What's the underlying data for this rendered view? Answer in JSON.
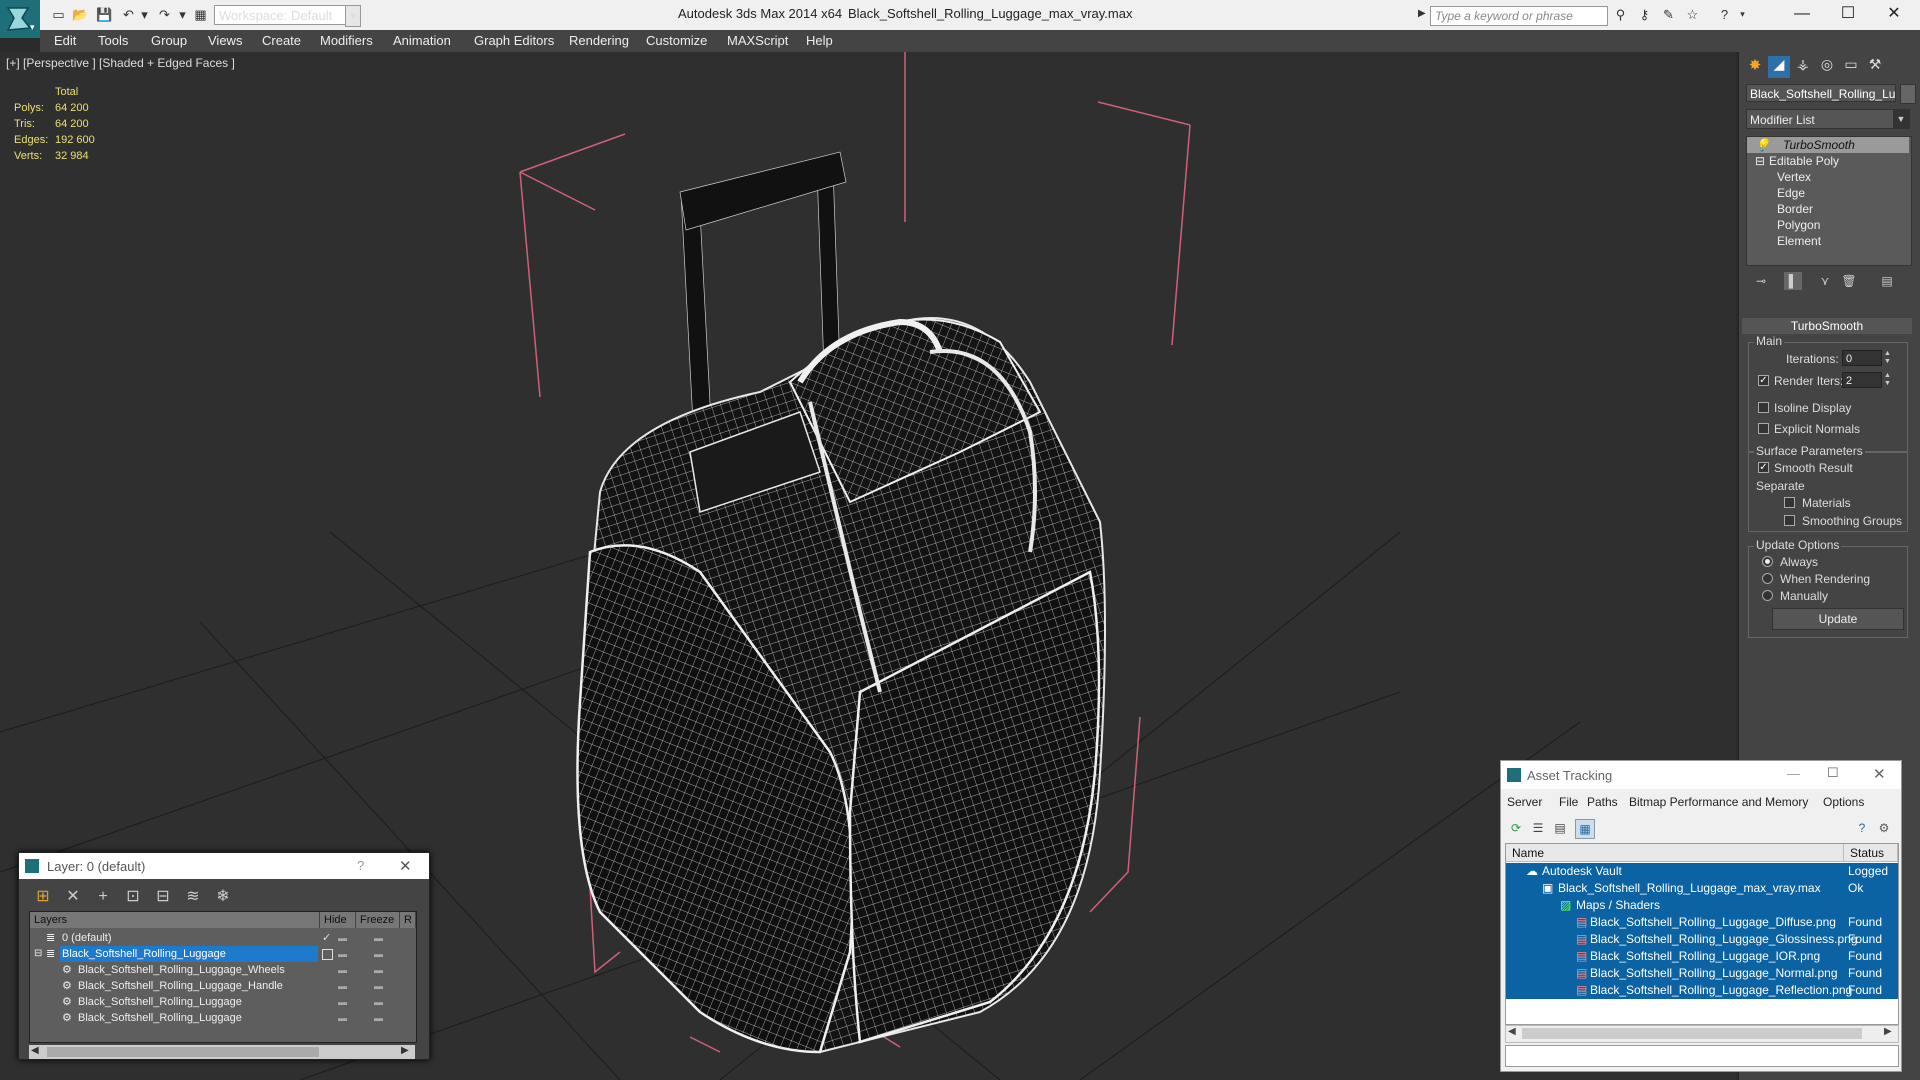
{
  "titlebar": {
    "workspace": "Workspace: Default",
    "app_title": "Autodesk 3ds Max  2014 x64",
    "file_title": "Black_Softshell_Rolling_Luggage_max_vray.max",
    "search_placeholder": "Type a keyword or phrase"
  },
  "menu": [
    "Edit",
    "Tools",
    "Group",
    "Views",
    "Create",
    "Modifiers",
    "Animation",
    "Graph Editors",
    "Rendering",
    "Customize",
    "MAXScript",
    "Help"
  ],
  "viewport": {
    "label": "[+] [Perspective ] [Shaded + Edged Faces ]",
    "stats": {
      "header": "Total",
      "polys_label": "Polys:",
      "polys": "64 200",
      "tris_label": "Tris:",
      "tris": "64 200",
      "edges_label": "Edges:",
      "edges": "192 600",
      "verts_label": "Verts:",
      "verts": "32 984"
    }
  },
  "command_panel": {
    "object_name": "Black_Softshell_Rolling_Luggage",
    "modifier_list": "Modifier List",
    "stack": [
      "TurboSmooth",
      "Editable Poly",
      "Vertex",
      "Edge",
      "Border",
      "Polygon",
      "Element"
    ],
    "rollout_title": "TurboSmooth",
    "main_label": "Main",
    "iterations_label": "Iterations:",
    "iterations_value": "0",
    "render_iters_label": "Render Iters:",
    "render_iters_value": "2",
    "isoline_label": "Isoline Display",
    "explicit_normals_label": "Explicit Normals",
    "surface_params_label": "Surface Parameters",
    "smooth_result_label": "Smooth Result",
    "separate_label": "Separate",
    "materials_label": "Materials",
    "smoothing_groups_label": "Smoothing Groups",
    "update_options_label": "Update Options",
    "always_label": "Always",
    "when_rendering_label": "When Rendering",
    "manually_label": "Manually",
    "update_button": "Update"
  },
  "layer_dialog": {
    "title": "Layer: 0 (default)",
    "help": "?",
    "col_layers": "Layers",
    "col_hide": "Hide",
    "col_freeze": "Freeze",
    "col_r": "R",
    "rows": [
      {
        "name": "0 (default)"
      },
      {
        "name": "Black_Softshell_Rolling_Luggage"
      },
      {
        "name": "Black_Softshell_Rolling_Luggage_Wheels"
      },
      {
        "name": "Black_Softshell_Rolling_Luggage_Handle"
      },
      {
        "name": "Black_Softshell_Rolling_Luggage"
      },
      {
        "name": "Black_Softshell_Rolling_Luggage"
      }
    ]
  },
  "asset_dialog": {
    "title": "Asset Tracking",
    "menu": [
      "Server",
      "File",
      "Paths",
      "Bitmap Performance and Memory",
      "Options"
    ],
    "col_name": "Name",
    "col_status": "Status",
    "rows": [
      {
        "name": "Autodesk Vault",
        "status": "Logged"
      },
      {
        "name": "Black_Softshell_Rolling_Luggage_max_vray.max",
        "status": "Ok"
      },
      {
        "name": "Maps / Shaders",
        "status": ""
      },
      {
        "name": "Black_Softshell_Rolling_Luggage_Diffuse.png",
        "status": "Found"
      },
      {
        "name": "Black_Softshell_Rolling_Luggage_Glossiness.png",
        "status": "Found"
      },
      {
        "name": "Black_Softshell_Rolling_Luggage_IOR.png",
        "status": "Found"
      },
      {
        "name": "Black_Softshell_Rolling_Luggage_Normal.png",
        "status": "Found"
      },
      {
        "name": "Black_Softshell_Rolling_Luggage_Reflection.png",
        "status": "Found"
      }
    ]
  },
  "colors": {
    "accent": "#1e7acb",
    "selection": "#0b63a4",
    "stats": "#e8e070",
    "bbox": "#d0607a"
  }
}
